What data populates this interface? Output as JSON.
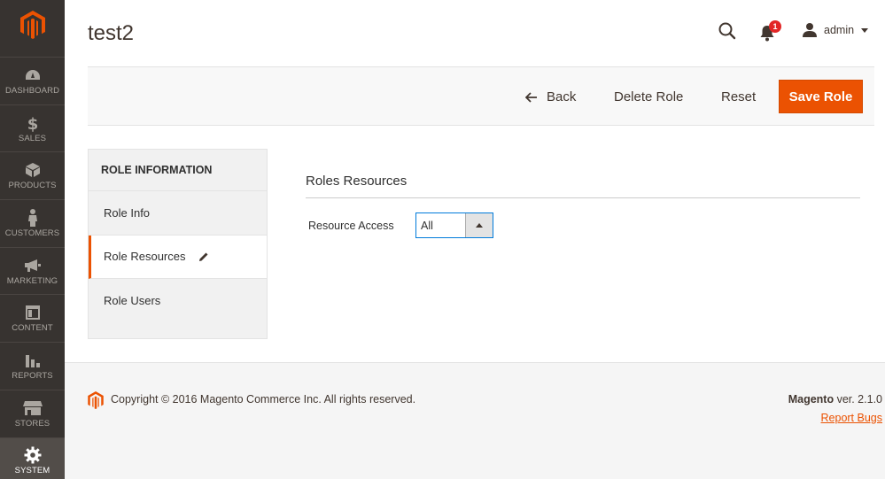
{
  "sidebar": {
    "logo": "magento-logo-icon",
    "items": [
      {
        "label": "DASHBOARD",
        "icon": "dashboard-gauge-icon"
      },
      {
        "label": "SALES",
        "icon": "dollar-icon"
      },
      {
        "label": "PRODUCTS",
        "icon": "cube-icon"
      },
      {
        "label": "CUSTOMERS",
        "icon": "person-icon"
      },
      {
        "label": "MARKETING",
        "icon": "megaphone-icon"
      },
      {
        "label": "CONTENT",
        "icon": "layout-icon"
      },
      {
        "label": "REPORTS",
        "icon": "bar-chart-icon"
      },
      {
        "label": "STORES",
        "icon": "storefront-icon"
      },
      {
        "label": "SYSTEM",
        "icon": "gear-icon"
      }
    ],
    "active": "SYSTEM"
  },
  "header": {
    "title": "test2",
    "notifications_count": "1",
    "user": "admin"
  },
  "actions": {
    "back": "Back",
    "delete": "Delete Role",
    "reset": "Reset",
    "save": "Save Role"
  },
  "tabs": {
    "title": "ROLE INFORMATION",
    "items": [
      "Role Info",
      "Role Resources",
      "Role Users"
    ],
    "active": "Role Resources"
  },
  "form": {
    "section_title": "Roles Resources",
    "resource_access_label": "Resource Access",
    "resource_access_value": "All"
  },
  "footer": {
    "copyright": "Copyright © 2016 Magento Commerce Inc. All rights reserved.",
    "brand": "Magento",
    "version": " ver. 2.1.0",
    "report_bugs": "Report Bugs"
  },
  "colors": {
    "accent": "#eb5202",
    "sidebar": "#373330",
    "focus": "#007bdb"
  }
}
